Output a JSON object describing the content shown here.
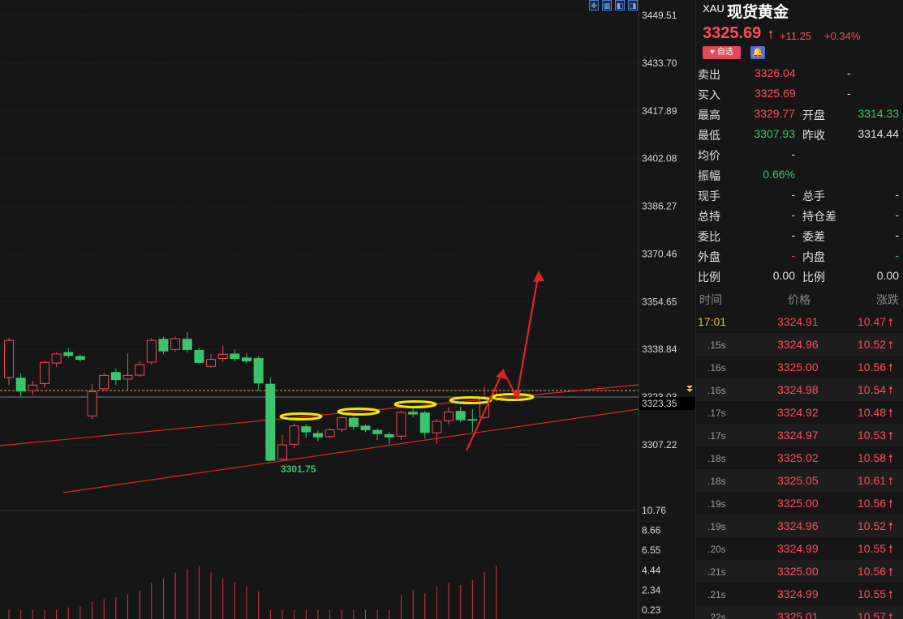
{
  "toolbar": {
    "icons": [
      "move-icon",
      "layout-grid-icon",
      "panel-left-icon",
      "panel-right-icon"
    ]
  },
  "chart_data": {
    "type": "candlestick",
    "price_axis": [
      "3449.51",
      "3433.70",
      "3417.89",
      "3402.08",
      "3386.27",
      "3370.46",
      "3354.65",
      "3338.84",
      "3323.03",
      "3307.22"
    ],
    "current_price_label": "3323.35",
    "low_annotation": "3301.75",
    "ylim": [
      3301.75,
      3449.51
    ],
    "candles": [
      {
        "o": 3329.5,
        "c": 3341.8,
        "h": 3342.6,
        "l": 3327.0
      },
      {
        "o": 3329.3,
        "c": 3325.0,
        "h": 3331.0,
        "l": 3323.3
      },
      {
        "o": 3325.2,
        "c": 3327.0,
        "h": 3328.4,
        "l": 3323.8
      },
      {
        "o": 3327.5,
        "c": 3334.5,
        "h": 3335.2,
        "l": 3326.2
      },
      {
        "o": 3334.3,
        "c": 3337.3,
        "h": 3337.9,
        "l": 3333.0
      },
      {
        "o": 3337.8,
        "c": 3336.8,
        "h": 3339.2,
        "l": 3336.0
      },
      {
        "o": 3336.5,
        "c": 3335.5,
        "h": 3337.1,
        "l": 3334.8
      },
      {
        "o": 3316.8,
        "c": 3324.8,
        "h": 3327.4,
        "l": 3315.8
      },
      {
        "o": 3325.8,
        "c": 3330.2,
        "h": 3331.0,
        "l": 3325.0
      },
      {
        "o": 3331.2,
        "c": 3328.8,
        "h": 3332.5,
        "l": 3327.0
      },
      {
        "o": 3329.0,
        "c": 3330.2,
        "h": 3337.6,
        "l": 3325.2
      },
      {
        "o": 3330.3,
        "c": 3333.8,
        "h": 3334.9,
        "l": 3329.8
      },
      {
        "o": 3334.6,
        "c": 3341.8,
        "h": 3342.6,
        "l": 3333.8
      },
      {
        "o": 3342.2,
        "c": 3338.3,
        "h": 3343.0,
        "l": 3337.2
      },
      {
        "o": 3338.8,
        "c": 3342.4,
        "h": 3343.0,
        "l": 3338.1
      },
      {
        "o": 3342.2,
        "c": 3338.8,
        "h": 3344.5,
        "l": 3337.8
      },
      {
        "o": 3338.5,
        "c": 3334.5,
        "h": 3339.4,
        "l": 3334.0
      },
      {
        "o": 3333.2,
        "c": 3335.5,
        "h": 3337.4,
        "l": 3332.8
      },
      {
        "o": 3335.8,
        "c": 3337.2,
        "h": 3340.0,
        "l": 3334.6
      },
      {
        "o": 3337.3,
        "c": 3335.8,
        "h": 3338.8,
        "l": 3335.0
      },
      {
        "o": 3336.0,
        "c": 3335.0,
        "h": 3337.4,
        "l": 3334.2
      },
      {
        "o": 3335.8,
        "c": 3327.7,
        "h": 3336.6,
        "l": 3325.2
      },
      {
        "o": 3327.3,
        "c": 3302.1,
        "h": 3329.4,
        "l": 3301.75
      },
      {
        "o": 3302.4,
        "c": 3307.2,
        "h": 3310.5,
        "l": 3302.0
      },
      {
        "o": 3307.4,
        "c": 3313.5,
        "h": 3314.3,
        "l": 3306.1
      },
      {
        "o": 3313.2,
        "c": 3311.5,
        "h": 3314.0,
        "l": 3309.6
      },
      {
        "o": 3311.0,
        "c": 3309.8,
        "h": 3312.1,
        "l": 3308.3
      },
      {
        "o": 3310.0,
        "c": 3312.2,
        "h": 3312.7,
        "l": 3309.4
      },
      {
        "o": 3312.3,
        "c": 3316.2,
        "h": 3316.7,
        "l": 3311.4
      },
      {
        "o": 3316.0,
        "c": 3313.3,
        "h": 3316.5,
        "l": 3312.2
      },
      {
        "o": 3313.4,
        "c": 3312.2,
        "h": 3313.9,
        "l": 3311.4
      },
      {
        "o": 3312.0,
        "c": 3310.9,
        "h": 3312.7,
        "l": 3308.8
      },
      {
        "o": 3310.6,
        "c": 3309.8,
        "h": 3311.5,
        "l": 3307.3
      },
      {
        "o": 3310.1,
        "c": 3318.0,
        "h": 3318.7,
        "l": 3308.8
      },
      {
        "o": 3318.0,
        "c": 3317.4,
        "h": 3319.4,
        "l": 3316.2
      },
      {
        "o": 3317.8,
        "c": 3311.3,
        "h": 3318.5,
        "l": 3309.3
      },
      {
        "o": 3311.2,
        "c": 3315.0,
        "h": 3315.8,
        "l": 3307.6
      },
      {
        "o": 3315.2,
        "c": 3318.1,
        "h": 3319.6,
        "l": 3314.0
      },
      {
        "o": 3318.3,
        "c": 3315.5,
        "h": 3319.8,
        "l": 3314.7
      },
      {
        "o": 3315.6,
        "c": 3315.5,
        "h": 3319.0,
        "l": 3311.5
      },
      {
        "o": 3316.3,
        "c": 3322.8,
        "h": 3326.5,
        "l": 3315.8
      },
      {
        "o": 3322.8,
        "c": 3323.4,
        "h": 3325.5,
        "l": 3321.7
      }
    ],
    "oscillator_axis": [
      "10.76",
      "8.66",
      "6.55",
      "4.44",
      "2.34",
      "0.23"
    ],
    "oscillator_values": [
      0.23,
      0.23,
      0.23,
      0.23,
      0.23,
      0.5,
      0.6,
      1.1,
      1.4,
      1.6,
      1.9,
      2.3,
      3.1,
      3.6,
      4.2,
      4.6,
      4.9,
      4.2,
      3.6,
      3.2,
      2.7,
      2.2,
      0.23,
      0.23,
      0.23,
      0.23,
      0.23,
      0.23,
      0.23,
      0.23,
      0.23,
      0.23,
      0.23,
      1.8,
      2.4,
      2.0,
      2.7,
      3.1,
      2.9,
      3.4,
      4.3,
      4.9
    ]
  },
  "panel": {
    "symbol": "XAU",
    "name": "现货黄金",
    "price": "3325.69",
    "change": "+11.25",
    "change_pct": "+0.34%",
    "fav_label": "自选",
    "colors": {
      "up": "#ff4d5a",
      "down": "#3bc46c",
      "accent": "#e8b84a"
    },
    "quotes": [
      {
        "l1": "卖出",
        "v1": "3326.04",
        "c1": "red",
        "l2": "",
        "v2": "-",
        "c2": "white"
      },
      {
        "l1": "买入",
        "v1": "3325.69",
        "c1": "red",
        "l2": "",
        "v2": "-",
        "c2": "white"
      },
      {
        "l1": "最高",
        "v1": "3329.77",
        "c1": "red",
        "l2": "开盘",
        "v2": "3314.33",
        "c2": "green"
      },
      {
        "l1": "最低",
        "v1": "3307.93",
        "c1": "green",
        "l2": "昨收",
        "v2": "3314.44",
        "c2": "white"
      },
      {
        "l1": "均价",
        "v1": "-",
        "c1": "white",
        "l2": "",
        "v2": "",
        "c2": "white"
      },
      {
        "l1": "振幅",
        "v1": "0.66%",
        "c1": "green",
        "l2": "",
        "v2": "",
        "c2": "white"
      },
      {
        "l1": "现手",
        "v1": "-",
        "c1": "white",
        "l2": "总手",
        "v2": "-",
        "c2": "white"
      },
      {
        "l1": "总持",
        "v1": "-",
        "c1": "white",
        "l2": "持仓差",
        "v2": "-",
        "c2": "white"
      },
      {
        "l1": "委比",
        "v1": "-",
        "c1": "white",
        "l2": "委差",
        "v2": "-",
        "c2": "white"
      },
      {
        "l1": "外盘",
        "v1": "-",
        "c1": "red",
        "l2": "内盘",
        "v2": "-",
        "c2": "green"
      },
      {
        "l1": "比例",
        "v1": "0.00",
        "c1": "white",
        "l2": "比例",
        "v2": "0.00",
        "c2": "white"
      }
    ],
    "ticks_header": {
      "time": "时间",
      "price": "价格",
      "change": "涨跌"
    },
    "ticks": [
      {
        "time": "17:01",
        "price": "3324.91",
        "change": "10.47"
      },
      {
        "time": ".15s",
        "price": "3324.96",
        "change": "10.52"
      },
      {
        "time": ".16s",
        "price": "3325.00",
        "change": "10.56"
      },
      {
        "time": ".16s",
        "price": "3324.98",
        "change": "10.54"
      },
      {
        "time": ".17s",
        "price": "3324.92",
        "change": "10.48"
      },
      {
        "time": ".17s",
        "price": "3324.97",
        "change": "10.53"
      },
      {
        "time": ".18s",
        "price": "3325.02",
        "change": "10.58"
      },
      {
        "time": ".18s",
        "price": "3325.05",
        "change": "10.61"
      },
      {
        "time": ".19s",
        "price": "3325.00",
        "change": "10.56"
      },
      {
        "time": ".19s",
        "price": "3324.96",
        "change": "10.52"
      },
      {
        "time": ".20s",
        "price": "3324.99",
        "change": "10.55"
      },
      {
        "time": ".21s",
        "price": "3325.00",
        "change": "10.56"
      },
      {
        "time": ".21s",
        "price": "3324.99",
        "change": "10.55"
      },
      {
        "time": ".22s",
        "price": "3325.01",
        "change": "10.57"
      }
    ]
  }
}
